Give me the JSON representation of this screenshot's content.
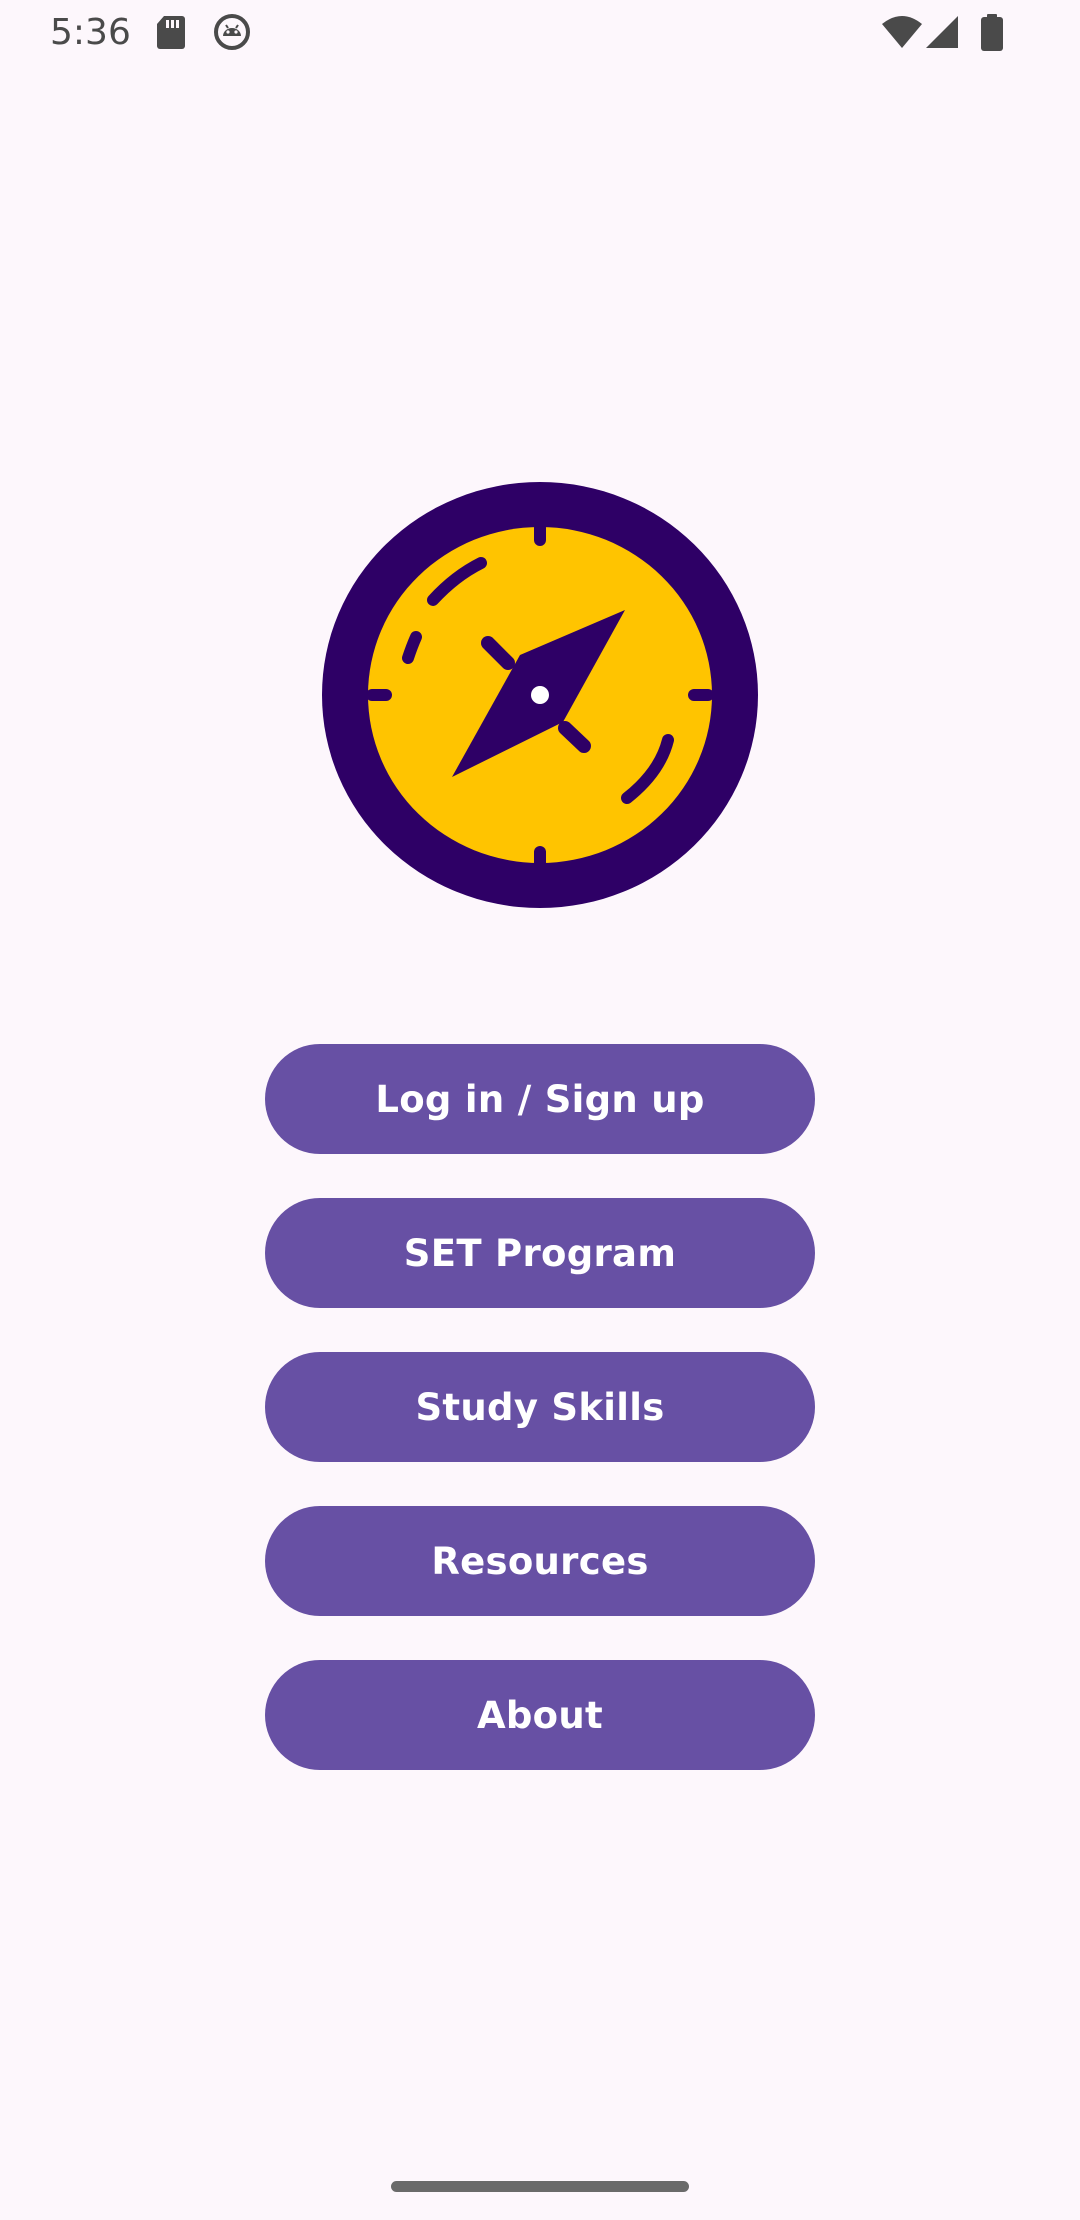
{
  "status_bar": {
    "time": "5:36",
    "icons": [
      "sd-card-icon",
      "android-icon",
      "wifi-icon",
      "signal-icon",
      "battery-icon"
    ]
  },
  "logo": {
    "icon": "compass-icon",
    "colors": {
      "ring": "#2E0066",
      "face": "#FFC400"
    }
  },
  "menu": {
    "buttons": [
      {
        "label": "Log in / Sign up"
      },
      {
        "label": "SET Program"
      },
      {
        "label": "Study Skills"
      },
      {
        "label": "Resources"
      },
      {
        "label": "About"
      }
    ],
    "button_color": "#6750A4",
    "text_color": "#FFFFFF"
  },
  "theme": {
    "background": "#FDF7FC"
  }
}
